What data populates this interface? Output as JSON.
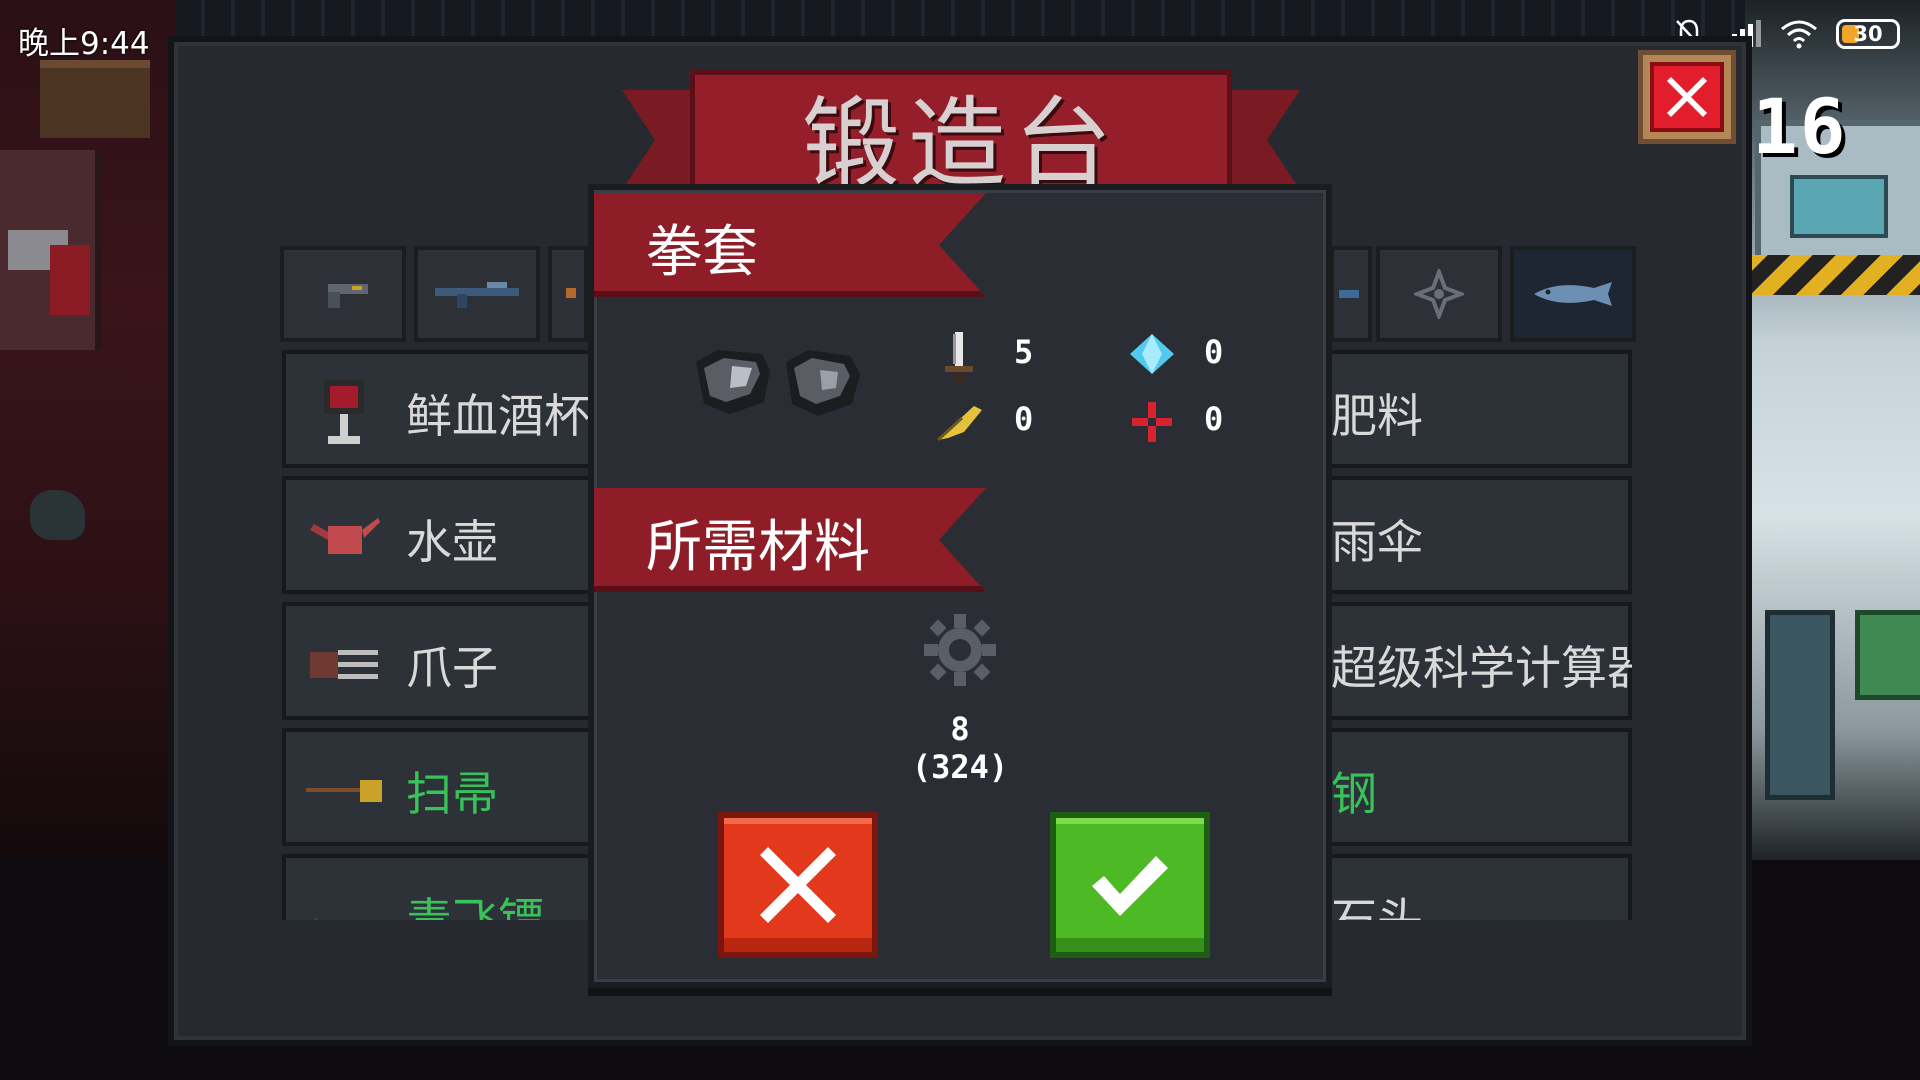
{
  "status_bar": {
    "time": "晚上9:44",
    "battery": "30",
    "icons": [
      "mute-bell-icon",
      "signal-icon",
      "wifi-icon",
      "battery-icon"
    ]
  },
  "top_right_counter": "16",
  "forge": {
    "title": "锻造台",
    "tabs": [
      {
        "icon": "pistol-icon"
      },
      {
        "icon": "rifle-icon"
      },
      {
        "icon": "weapon-icon"
      },
      {
        "icon": "gun-icon"
      },
      {
        "icon": "compass-icon"
      },
      {
        "icon": "fish-icon"
      }
    ],
    "list_left": [
      {
        "label": "鲜血酒杯",
        "icon": "goblet-icon",
        "color": "#d9d9d9"
      },
      {
        "label": "水壶",
        "icon": "watering-can-icon",
        "color": "#d9d9d9"
      },
      {
        "label": "爪子",
        "icon": "claw-icon",
        "color": "#d9d9d9"
      },
      {
        "label": "扫帚",
        "icon": "broom-icon",
        "color": "#38c25a"
      },
      {
        "label": "毒飞镖",
        "icon": "dart-icon",
        "color": "#38c25a"
      }
    ],
    "list_right": [
      {
        "label": "肥料"
      },
      {
        "label": "雨伞"
      },
      {
        "label": "超级科学计算器"
      },
      {
        "label": "钢",
        "color": "#38c25a"
      },
      {
        "label": "石头"
      }
    ]
  },
  "dialog": {
    "item_name": "拳套",
    "item_icon": "gauntlet-icon",
    "stats": [
      {
        "icon": "sword-icon",
        "value": "5"
      },
      {
        "icon": "diamond-icon",
        "value": "0"
      },
      {
        "icon": "feather-icon",
        "value": "0"
      },
      {
        "icon": "crosshair-icon",
        "value": "0"
      }
    ],
    "materials_title": "所需材料",
    "material": {
      "icon": "gear-icon",
      "count": "8",
      "stock": "(324)"
    },
    "cancel_icon": "close-icon",
    "confirm_icon": "checkmark-icon"
  }
}
